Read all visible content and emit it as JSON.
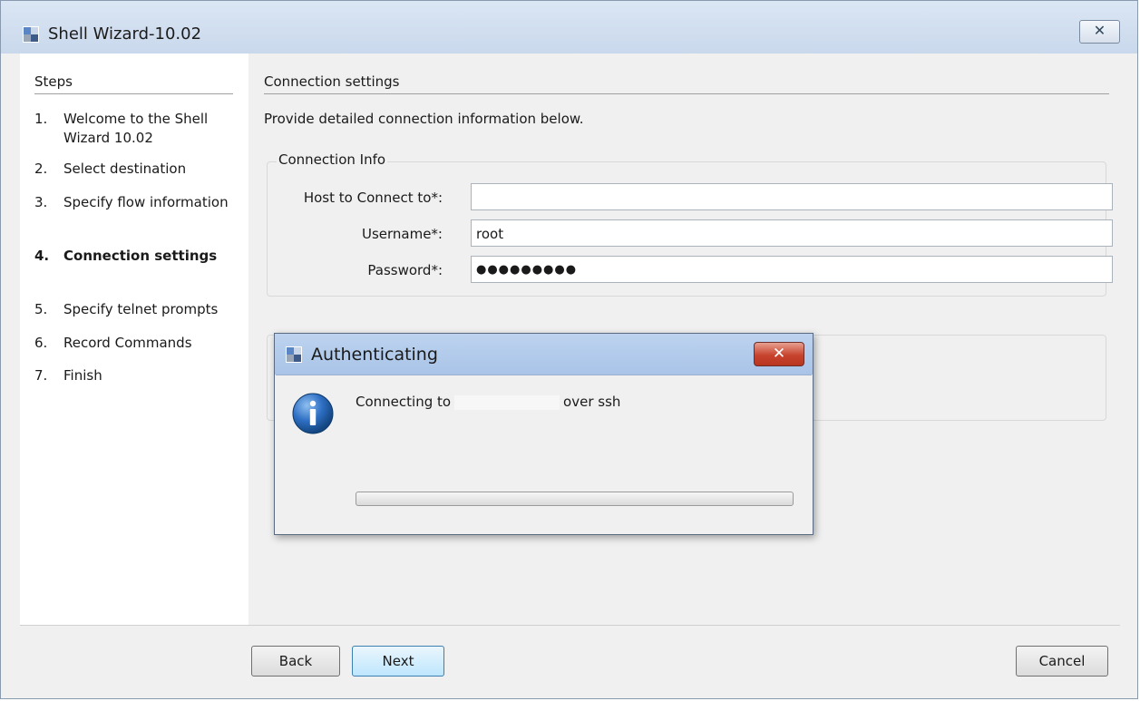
{
  "window": {
    "title": "Shell Wizard-10.02",
    "close_label": "✕"
  },
  "steps": {
    "header": "Steps",
    "items": [
      {
        "num": "1.",
        "label": "Welcome to the Shell Wizard 10.02"
      },
      {
        "num": "2.",
        "label": "Select destination"
      },
      {
        "num": "3.",
        "label": "Specify flow information"
      },
      {
        "num": "4.",
        "label": "Connection settings",
        "active": true
      },
      {
        "num": "5.",
        "label": "Specify telnet prompts"
      },
      {
        "num": "6.",
        "label": "Record Commands"
      },
      {
        "num": "7.",
        "label": "Finish"
      }
    ]
  },
  "content": {
    "header": "Connection settings",
    "description": "Provide detailed connection information below.",
    "connection_info": {
      "title": "Connection Info",
      "host_label": "Host to Connect to*:",
      "host_value": "",
      "username_label": "Username*:",
      "username_value": "root",
      "password_label": "Password*:",
      "password_value": "●●●●●●●●●"
    }
  },
  "footer": {
    "back_label": "Back",
    "next_label": "Next",
    "cancel_label": "Cancel"
  },
  "dialog": {
    "title": "Authenticating",
    "close_label": "✕",
    "message_prefix": "Connecting to",
    "message_suffix": "over ssh",
    "progress": 0
  }
}
